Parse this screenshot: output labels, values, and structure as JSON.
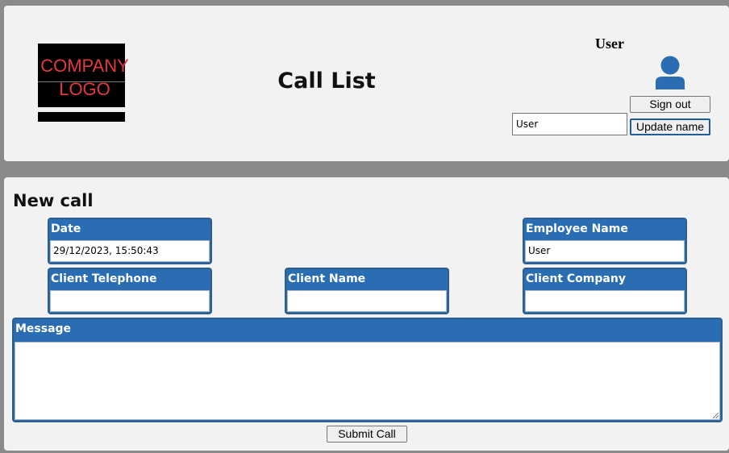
{
  "header": {
    "logo_line1": "COMPANY",
    "logo_line2": "LOGO",
    "title": "Call List",
    "user_label": "User",
    "signout_label": "Sign out",
    "update_label": "Update name",
    "name_input_value": "User",
    "avatar_icon": "user-avatar-icon"
  },
  "form": {
    "title": "New call",
    "fields": {
      "date": {
        "label": "Date",
        "value": "29/12/2023, 15:50:43"
      },
      "employee": {
        "label": "Employee Name",
        "value": "User"
      },
      "client_telephone": {
        "label": "Client Telephone",
        "value": ""
      },
      "client_name": {
        "label": "Client Name",
        "value": ""
      },
      "client_company": {
        "label": "Client Company",
        "value": ""
      },
      "message": {
        "label": "Message",
        "value": ""
      }
    },
    "submit_label": "Submit Call"
  },
  "colors": {
    "page_bg": "#8a8a8a",
    "panel_bg": "#f2f2f2",
    "field_header": "#2a6db2",
    "logo_text": "#e5393c",
    "avatar": "#2a6db2"
  }
}
